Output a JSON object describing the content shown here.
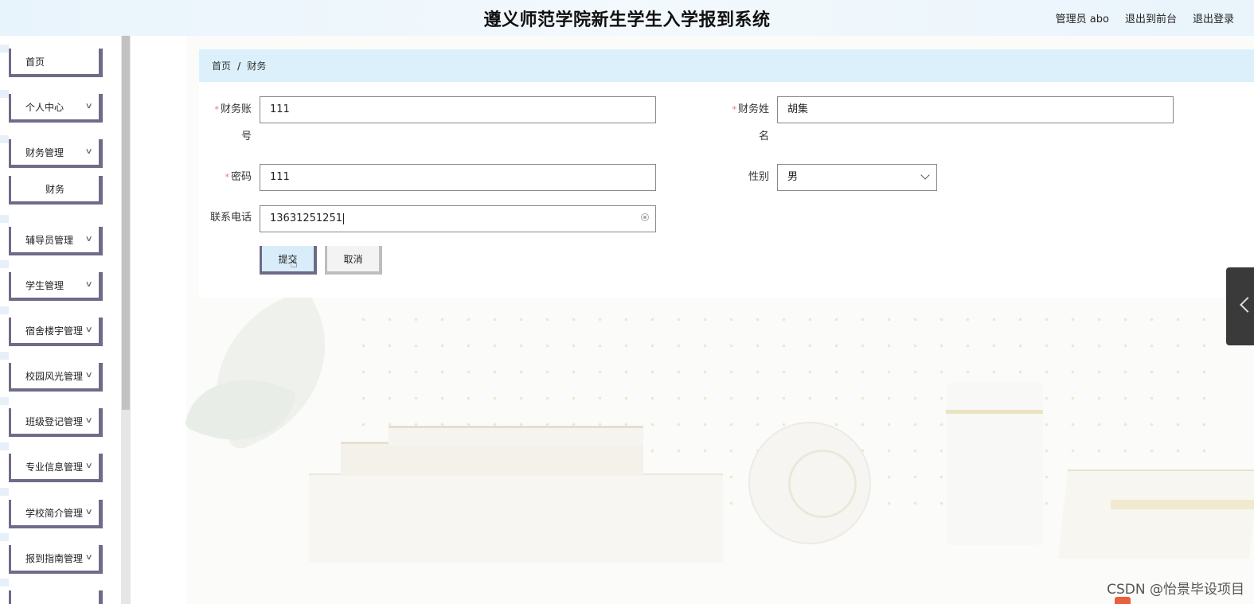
{
  "header": {
    "title": "遵义师范学院新生学生入学报到系统",
    "user_label": "管理员 abo",
    "front_link": "退出到前台",
    "logout_link": "退出登录"
  },
  "sidebar": {
    "items": [
      {
        "label": "首页"
      },
      {
        "label": "个人中心"
      },
      {
        "label": "财务管理"
      },
      {
        "label": "财务"
      },
      {
        "label": "辅导员管理"
      },
      {
        "label": "学生管理"
      },
      {
        "label": "宿舍楼宇管理"
      },
      {
        "label": "校园风光管理"
      },
      {
        "label": "班级登记管理"
      },
      {
        "label": "专业信息管理"
      },
      {
        "label": "学校简介管理"
      },
      {
        "label": "报到指南管理"
      }
    ]
  },
  "breadcrumb": {
    "home": "首页",
    "separator": "/",
    "current": "财务"
  },
  "form": {
    "account_label_line1": "财务账",
    "account_label_line2": "号",
    "account_value": "111",
    "name_label_line1": "财务姓",
    "name_label_line2": "名",
    "name_value": "胡集",
    "password_label": "密码",
    "password_value": "111",
    "gender_label": "性别",
    "gender_value": "男",
    "phone_label": "联系电话",
    "phone_value": "13631251251",
    "required_mark": "*",
    "submit_label": "提交",
    "cancel_label": "取消"
  },
  "watermark": "CSDN @怡景毕设项目",
  "colors": {
    "accent_border": "#706b88",
    "breadcrumb_bg": "#dcf0fb",
    "required": "#f56c6c"
  }
}
